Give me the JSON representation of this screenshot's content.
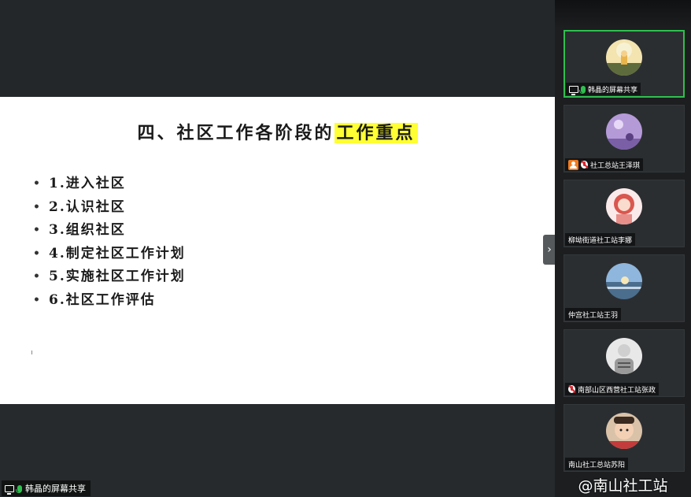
{
  "slide": {
    "title_part1": "四、社区工作各阶段的",
    "title_highlight": "工作重点",
    "highlight_color": "#ffff33",
    "bullets": [
      "1.进入社区",
      "2.认识社区",
      "3.组织社区",
      "4.制定社区工作计划",
      "5.实施社区工作计划",
      "6.社区工作评估"
    ]
  },
  "share_label": "韩晶的屏幕共享",
  "collapse_icon": "chevron-right-icon",
  "participants": [
    {
      "name": "韩晶的屏幕共享",
      "active": true,
      "icons": [
        "screen-share-icon",
        "mic-on-icon"
      ]
    },
    {
      "name": "社工总站王泽琪",
      "active": false,
      "icons": [
        "host-icon",
        "mic-muted-icon"
      ]
    },
    {
      "name": "柳坳街道社工站李娜",
      "active": false,
      "icons": []
    },
    {
      "name": "仲宫社工站王羽",
      "active": false,
      "icons": []
    },
    {
      "name": "南部山区西营社工站张政",
      "active": false,
      "icons": [
        "mic-muted-icon"
      ]
    },
    {
      "name": "南山社工总站苏阳",
      "active": false,
      "icons": []
    }
  ],
  "watermark": "@南山社工站",
  "accent_color": "#2fbf4f"
}
